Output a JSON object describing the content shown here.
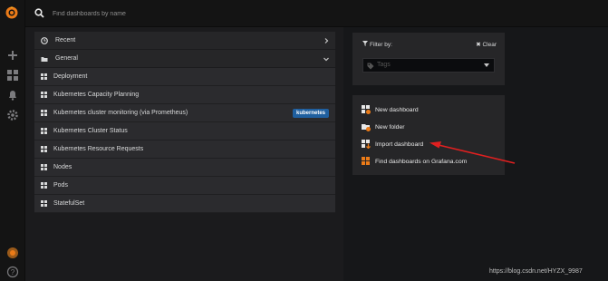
{
  "search": {
    "placeholder": "Find dashboards by name"
  },
  "list": {
    "sections": [
      {
        "label": "Recent",
        "icon": "clock-icon",
        "expanded": false
      },
      {
        "label": "General",
        "icon": "folder-open-icon",
        "expanded": true
      }
    ],
    "items": [
      {
        "label": "Deployment",
        "tag": ""
      },
      {
        "label": "Kubernetes Capacity Planning",
        "tag": ""
      },
      {
        "label": "Kubernetes cluster monitoring (via Prometheus)",
        "tag": "kubernetes"
      },
      {
        "label": "Kubernetes Cluster Status",
        "tag": ""
      },
      {
        "label": "Kubernetes Resource Requests",
        "tag": ""
      },
      {
        "label": "Nodes",
        "tag": ""
      },
      {
        "label": "Pods",
        "tag": ""
      },
      {
        "label": "StatefulSet",
        "tag": ""
      }
    ]
  },
  "filter": {
    "label": "Filter by:",
    "clear_label": "Clear",
    "tags_placeholder": "Tags"
  },
  "actions": [
    {
      "label": "New dashboard",
      "icon": "new-dashboard-icon"
    },
    {
      "label": "New folder",
      "icon": "new-folder-icon"
    },
    {
      "label": "Import dashboard",
      "icon": "import-dashboard-icon"
    },
    {
      "label": "Find dashboards on Grafana.com",
      "icon": "grafana-com-icon"
    }
  ],
  "colors": {
    "accent": "#eb7b18",
    "tag_bg": "#1f5f9f",
    "arrow": "#e02020"
  },
  "watermark": "https://blog.csdn.net/HYZX_9987"
}
